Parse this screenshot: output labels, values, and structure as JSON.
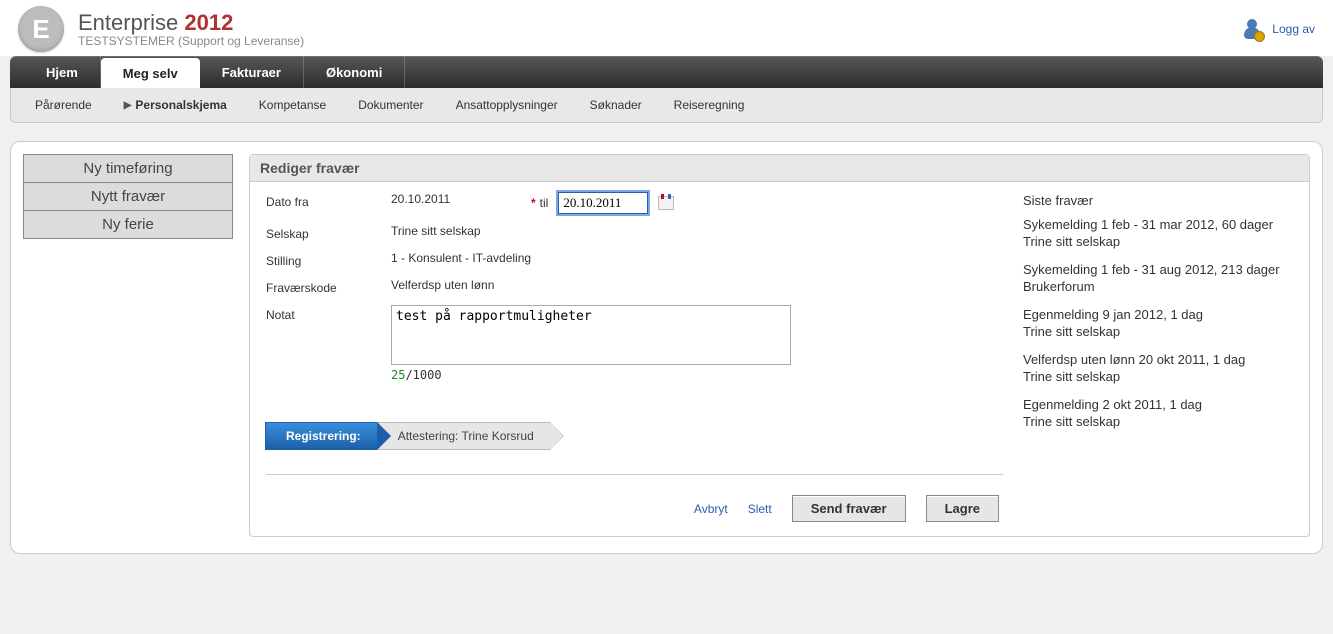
{
  "header": {
    "brand_main": "Enterprise",
    "brand_year": "2012",
    "brand_sub": "TESTSYSTEMER (Support og Leveranse)",
    "logout_label": "Logg av"
  },
  "topnav": {
    "tabs": [
      {
        "label": "Hjem"
      },
      {
        "label": "Meg selv"
      },
      {
        "label": "Fakturaer"
      },
      {
        "label": "Økonomi"
      }
    ]
  },
  "subnav": {
    "items": [
      {
        "label": "Pårørende"
      },
      {
        "label": "Personalskjema"
      },
      {
        "label": "Kompetanse"
      },
      {
        "label": "Dokumenter"
      },
      {
        "label": "Ansattopplysninger"
      },
      {
        "label": "Søknader"
      },
      {
        "label": "Reiseregning"
      }
    ]
  },
  "leftbtns": {
    "items": [
      {
        "label": "Ny timeføring"
      },
      {
        "label": "Nytt fravær"
      },
      {
        "label": "Ny ferie"
      }
    ]
  },
  "form": {
    "title": "Rediger fravær",
    "labels": {
      "dato_fra": "Dato fra",
      "til": "til",
      "selskap": "Selskap",
      "stilling": "Stilling",
      "fravaerskode": "Fraværskode",
      "notat": "Notat"
    },
    "values": {
      "dato_fra": "20.10.2011",
      "til": "20.10.2011",
      "selskap": "Trine sitt selskap",
      "stilling": "1 - Konsulent - IT-avdeling",
      "fravaerskode": "Velferdsp uten lønn",
      "notat": "test på rapportmuligheter"
    },
    "counter": {
      "current": "25",
      "sep_max": "/1000"
    }
  },
  "workflow": {
    "steps": [
      {
        "label": "Registrering:"
      },
      {
        "label": "Attestering: Trine Korsrud"
      }
    ]
  },
  "history": {
    "title": "Siste fravær",
    "items": [
      {
        "line1": "Sykemelding 1 feb - 31 mar 2012, 60 dager",
        "line2": "Trine sitt selskap"
      },
      {
        "line1": "Sykemelding 1 feb - 31 aug 2012, 213 dager",
        "line2": "Brukerforum"
      },
      {
        "line1": "Egenmelding 9 jan 2012, 1 dag",
        "line2": "Trine sitt selskap"
      },
      {
        "line1": "Velferdsp uten lønn 20 okt 2011, 1 dag",
        "line2": "Trine sitt selskap"
      },
      {
        "line1": "Egenmelding 2 okt 2011, 1 dag",
        "line2": "Trine sitt selskap"
      }
    ]
  },
  "footer": {
    "avbryt": "Avbryt",
    "slett": "Slett",
    "send": "Send fravær",
    "lagre": "Lagre"
  }
}
